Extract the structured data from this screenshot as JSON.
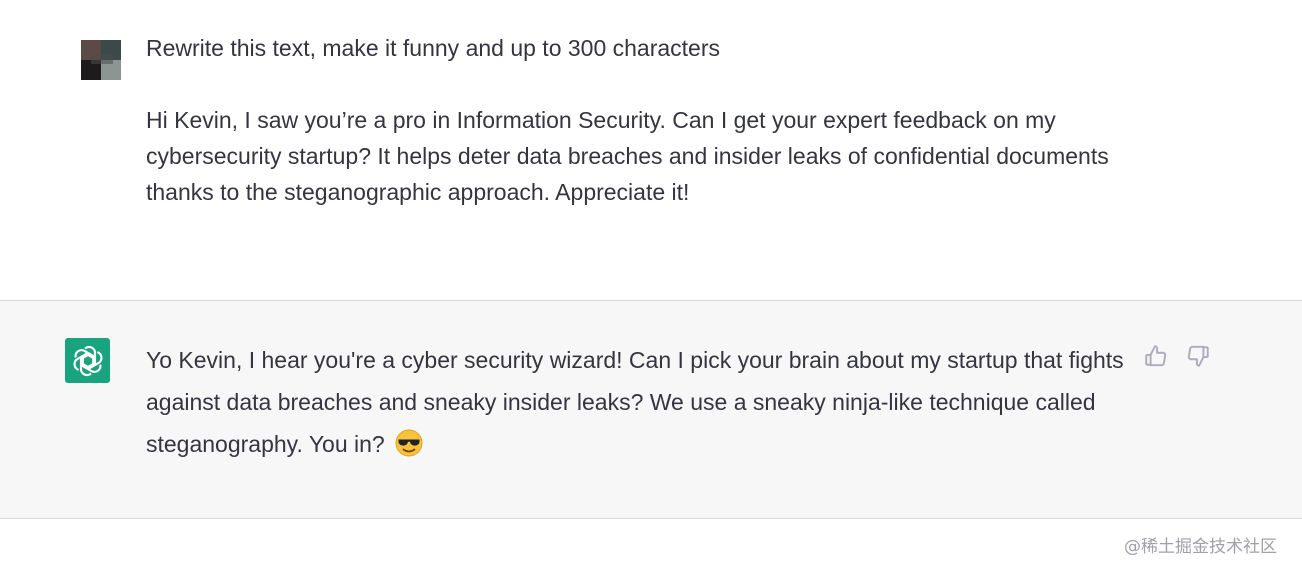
{
  "user_message": {
    "paragraphs": [
      "Rewrite this text, make it funny and up to 300 characters",
      "Hi Kevin, I saw you’re a pro in Information Security. Can I get your expert feedback on my cybersecurity startup? It helps deter data breaches and insider leaks of confidential documents thanks to the steganographic approach. Appreciate it!"
    ]
  },
  "assistant_message": {
    "text": "Yo Kevin, I hear you're a cyber security wizard! Can I pick your brain about my startup that fights against data breaches and sneaky insider leaks? We use a sneaky ninja-like technique called steganography. You in?",
    "emoji_icon": "smiling-face-with-sunglasses-emoji"
  },
  "feedback": {
    "thumbs_up_icon": "thumbs-up-icon",
    "thumbs_down_icon": "thumbs-down-icon"
  },
  "watermark": "@稀土掘金技术社区",
  "colors": {
    "assistant_bg": "#f7f7f8",
    "logo_bg": "#19a37f",
    "text": "#343541",
    "divider": "#d9d9e3"
  }
}
